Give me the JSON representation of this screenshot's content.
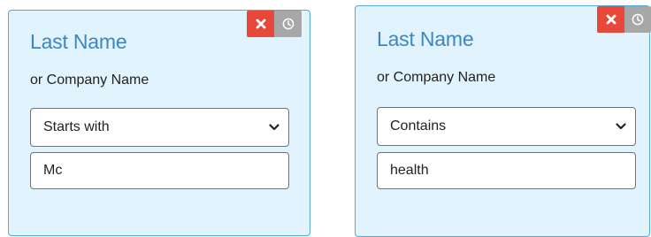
{
  "filters": [
    {
      "title": "Last Name",
      "subtitle": "or Company Name",
      "operator": "Starts with",
      "value": "Mc"
    },
    {
      "title": "Last Name",
      "subtitle": "or Company Name",
      "operator": "Contains",
      "value": "health"
    }
  ],
  "icons": {
    "remove": "close-icon",
    "history": "clock-icon"
  },
  "colors": {
    "card_background": "#e1f3fc",
    "card_border": "#5aa6d8",
    "title": "#3d86c4",
    "remove_button": "#e8483a",
    "history_button": "#a7a7a7"
  }
}
